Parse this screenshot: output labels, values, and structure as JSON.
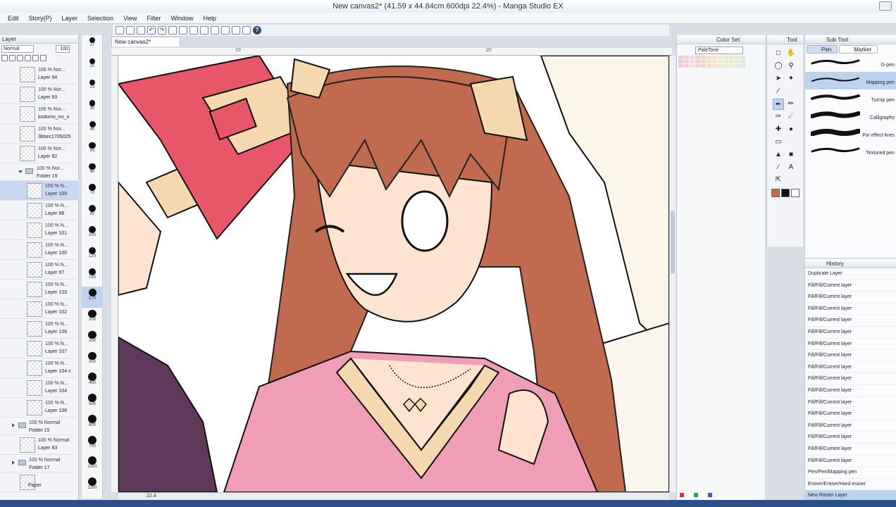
{
  "window": {
    "title": "New canvas2* (41.59 x 44.84cm 600dpi 22.4%) - Manga Studio EX"
  },
  "menu": [
    "Edit",
    "Story(P)",
    "Layer",
    "Selection",
    "View",
    "Filter",
    "Window",
    "Help"
  ],
  "layer_panel": {
    "tab": "Layer",
    "blend_mode": "Normal",
    "opacity": "100",
    "layers": [
      {
        "opacity": "100 % Nor...",
        "name": "Layer 94",
        "type": "layer"
      },
      {
        "opacity": "100 % Nor...",
        "name": "Layer 93",
        "type": "layer"
      },
      {
        "opacity": "100 % Nor...",
        "name": "kodomo_no_o",
        "type": "layer"
      },
      {
        "opacity": "100 % Nor...",
        "name": "3bbec1705025",
        "type": "layer"
      },
      {
        "opacity": "100 % Nor...",
        "name": "Layer 92",
        "type": "layer"
      },
      {
        "opacity": "100 % Nor...",
        "name": "Folder 19",
        "type": "folder"
      },
      {
        "opacity": "100 % N...",
        "name": "Layer 109",
        "type": "layer",
        "selected": true
      },
      {
        "opacity": "100 % N...",
        "name": "Layer 88",
        "type": "layer"
      },
      {
        "opacity": "100 % N...",
        "name": "Layer 101",
        "type": "layer"
      },
      {
        "opacity": "100 % N...",
        "name": "Layer 100",
        "type": "layer"
      },
      {
        "opacity": "100 % N...",
        "name": "Layer 97",
        "type": "layer"
      },
      {
        "opacity": "100 % N...",
        "name": "Layer 103",
        "type": "layer"
      },
      {
        "opacity": "100 % N...",
        "name": "Layer 102",
        "type": "layer"
      },
      {
        "opacity": "100 % N...",
        "name": "Layer 106",
        "type": "layer"
      },
      {
        "opacity": "100 % N...",
        "name": "Layer 107",
        "type": "layer"
      },
      {
        "opacity": "100 % N...",
        "name": "Layer 104 c",
        "type": "layer"
      },
      {
        "opacity": "100 % N...",
        "name": "Layer 104",
        "type": "layer"
      },
      {
        "opacity": "100 % N...",
        "name": "Layer 108",
        "type": "layer"
      },
      {
        "opacity": "100 % Normal",
        "name": "Folder 15",
        "type": "folder"
      },
      {
        "opacity": "100 % Normal",
        "name": "Layer 83",
        "type": "layer"
      },
      {
        "opacity": "100 % Normal",
        "name": "Folder 17",
        "type": "folder"
      },
      {
        "opacity": "",
        "name": "Paper",
        "type": "layer"
      }
    ]
  },
  "brush_sizes": [
    "17",
    "20",
    "25",
    "30",
    "40",
    "50",
    "60",
    "70",
    "80",
    "100",
    "120",
    "150",
    "170",
    "200",
    "250",
    "300",
    "400",
    "500",
    "600",
    "700",
    "1000",
    "1200"
  ],
  "canvas": {
    "tab": "New canvas2*",
    "ruler_marks": [
      "10",
      "20"
    ],
    "status": "22.4"
  },
  "color_panel": {
    "tab": "Color Set",
    "palette": "PaleTone"
  },
  "tool_panel": {
    "tab": "Tool"
  },
  "subtool_panel": {
    "tab": "Sub Tool",
    "tabs": [
      "Pen",
      "Marker"
    ],
    "pens": [
      "G-pen",
      "Mapping pen",
      "Turnip pen",
      "Calligraphy",
      "For effect lines",
      "Textured pen"
    ]
  },
  "history_panel": {
    "tab": "History",
    "items": [
      "Duplicate Layer",
      "Fill/Fill/Current layer",
      "Fill/Fill/Current layer",
      "Fill/Fill/Current layer",
      "Fill/Fill/Current layer",
      "Fill/Fill/Current layer",
      "Fill/Fill/Current layer",
      "Fill/Fill/Current layer",
      "Fill/Fill/Current layer",
      "Fill/Fill/Current layer",
      "Fill/Fill/Current layer",
      "Fill/Fill/Current layer",
      "Fill/Fill/Current layer",
      "Fill/Fill/Current layer",
      "Fill/Fill/Current layer",
      "Fill/Fill/Current layer",
      "Fill/Fill/Current layer",
      "Pen/Pen/Mapping pen",
      "Eraser/Eraser/Hard eraser",
      "New Raster Layer"
    ]
  }
}
